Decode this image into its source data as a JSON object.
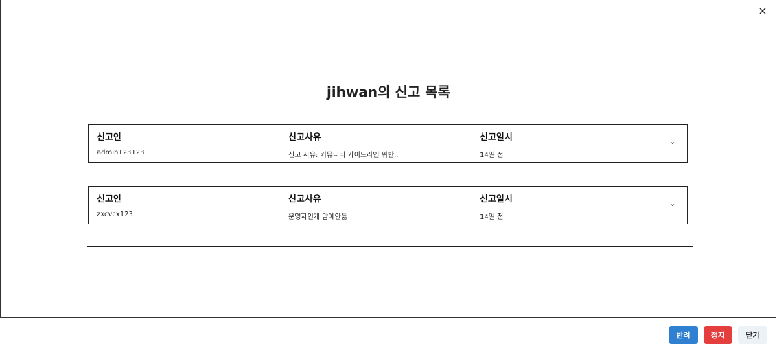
{
  "modal": {
    "title": "jihwan의 신고 목록",
    "close_icon": "×"
  },
  "columns": {
    "reporter": "신고인",
    "reason": "신고사유",
    "date": "신고일시"
  },
  "reports": [
    {
      "reporter": "admin123123",
      "reason": "신고 사유: 커뮤니티 가이드라인 위반..",
      "date": "14일 전"
    },
    {
      "reporter": "zxcvcx123",
      "reason": "운영자인게 맘에안듦",
      "date": "14일 전"
    }
  ],
  "expand_icon": "⌄",
  "footer": {
    "reject_label": "반려",
    "reject_color": "#2f80d1",
    "suspend_label": "정지",
    "suspend_color": "#e53e3e",
    "close_label": "닫기",
    "close_color": "#edf2f7"
  }
}
